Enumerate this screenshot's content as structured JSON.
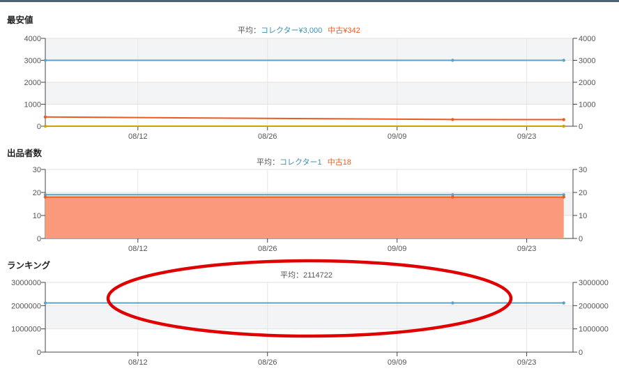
{
  "sections": {
    "lowest_price": {
      "title": "最安値",
      "average_label": "平均：",
      "collector_avg": "コレクター¥3,000",
      "used_avg": "中古¥342"
    },
    "seller_count": {
      "title": "出品者数",
      "average_label": "平均：",
      "collector_avg": "コレクター1",
      "used_avg": "中古18"
    },
    "ranking": {
      "title": "ランキング",
      "average_text": "平均：2114722"
    }
  },
  "colors": {
    "collector": "#5ba3c1",
    "used": "#ec5a1e",
    "used_fill": "#fb9a7a",
    "new": "#c8a400"
  },
  "annotation": {
    "shape": "ellipse",
    "color": "#e00000"
  },
  "chart_data": [
    {
      "type": "line",
      "title": "最安値",
      "x_ticks": [
        "08/12",
        "08/26",
        "09/09",
        "09/23"
      ],
      "x_range": [
        "2023-08-02",
        "2023-09-28"
      ],
      "ylim": [
        0,
        4000
      ],
      "yticks": [
        0,
        1000,
        2000,
        3000,
        4000
      ],
      "grid": true,
      "series": [
        {
          "name": "コレクター",
          "x": [
            "2023-08-02",
            "2023-09-15",
            "2023-09-27"
          ],
          "values": [
            3000,
            3000,
            3000
          ]
        },
        {
          "name": "中古",
          "x": [
            "2023-08-02",
            "2023-09-15",
            "2023-09-27"
          ],
          "values": [
            420,
            305,
            300
          ]
        },
        {
          "x": [
            "2023-08-02",
            "2023-09-27"
          ],
          "values": [
            0,
            0
          ]
        }
      ]
    },
    {
      "type": "area",
      "title": "出品者数",
      "x_ticks": [
        "08/12",
        "08/26",
        "09/09",
        "09/23"
      ],
      "x_range": [
        "2023-08-02",
        "2023-09-28"
      ],
      "ylim": [
        0,
        30
      ],
      "yticks": [
        0,
        10,
        20,
        30
      ],
      "grid": true,
      "series": [
        {
          "name": "コレクター",
          "x": [
            "2023-08-02",
            "2023-09-15",
            "2023-09-27"
          ],
          "values": [
            19,
            19,
            19
          ]
        },
        {
          "name": "中古",
          "x": [
            "2023-08-02",
            "2023-09-15",
            "2023-09-27"
          ],
          "values": [
            18,
            18,
            18
          ]
        }
      ]
    },
    {
      "type": "line",
      "title": "ランキング",
      "x_ticks": [
        "08/12",
        "08/26",
        "09/09",
        "09/23"
      ],
      "x_range": [
        "2023-08-02",
        "2023-09-28"
      ],
      "ylim": [
        0,
        3000000
      ],
      "yticks": [
        0,
        1000000,
        2000000,
        3000000
      ],
      "grid": true,
      "series": [
        {
          "x": [
            "2023-08-02",
            "2023-09-15",
            "2023-09-27"
          ],
          "values": [
            2114722,
            2114722,
            2114722
          ]
        }
      ]
    }
  ]
}
